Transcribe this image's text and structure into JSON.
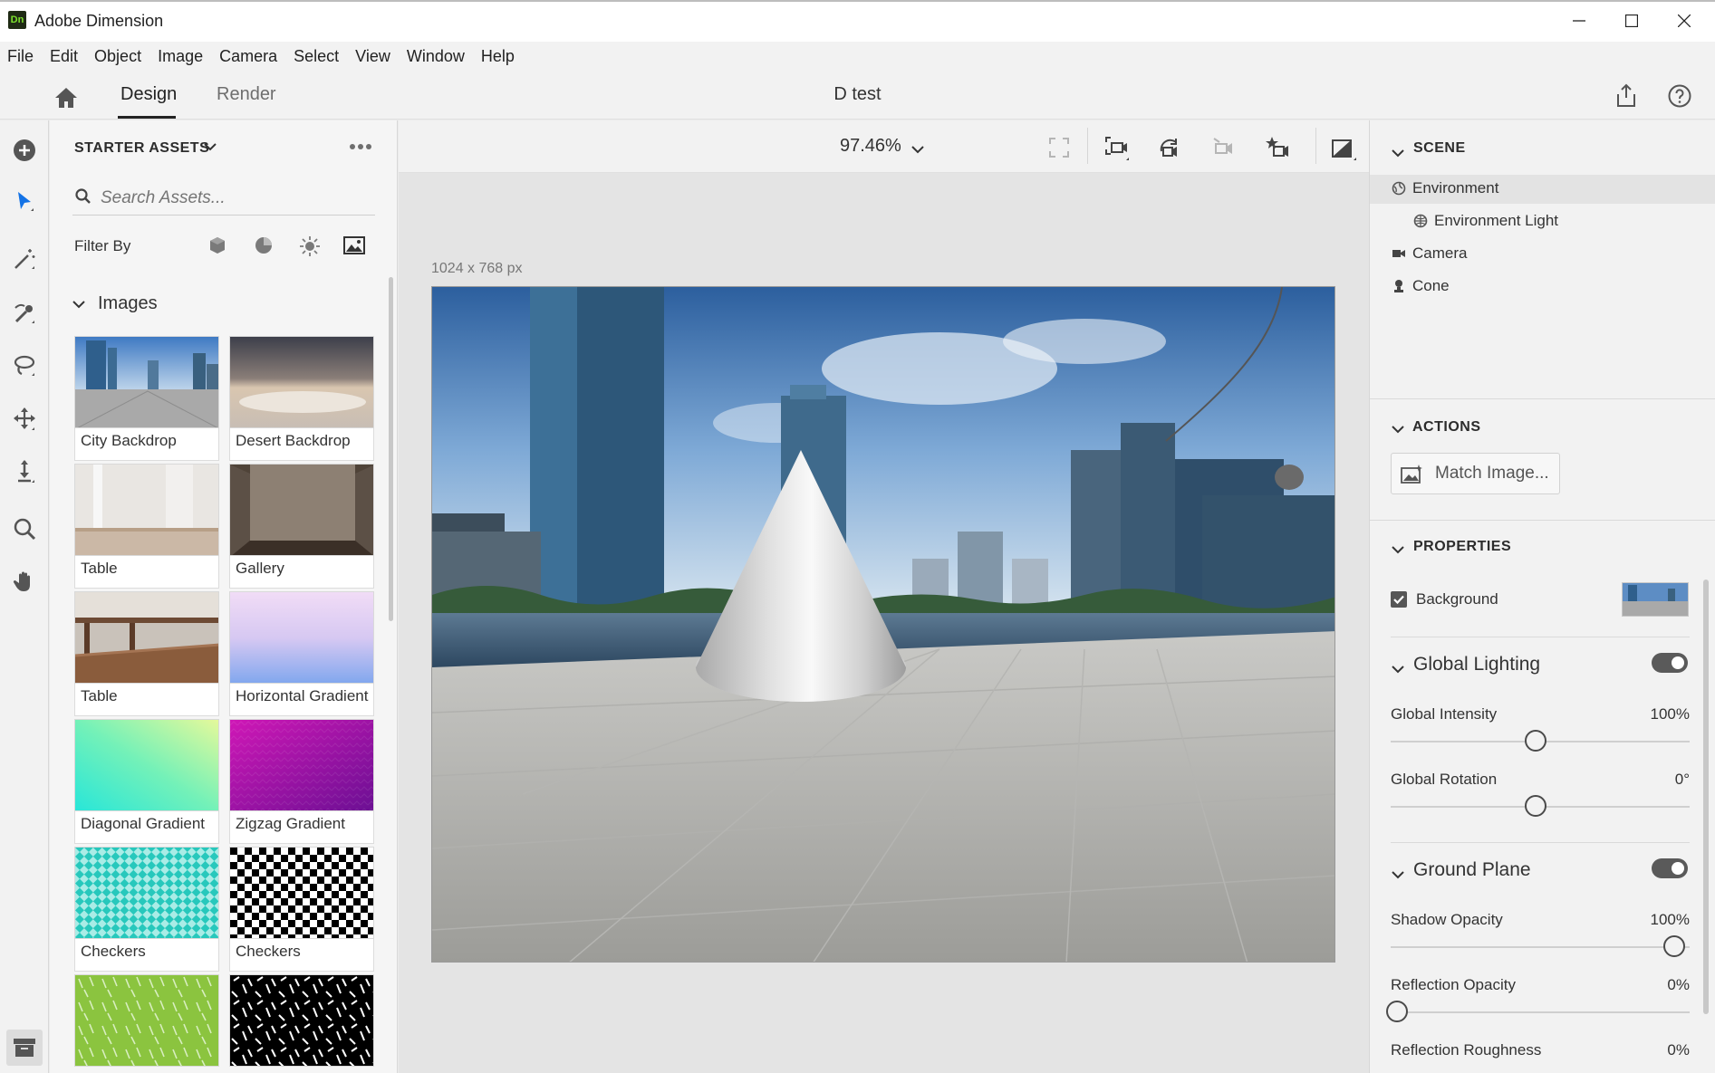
{
  "app": {
    "title": "Adobe Dimension",
    "logo_text": "Dn"
  },
  "menu": [
    "File",
    "Edit",
    "Object",
    "Image",
    "Camera",
    "Select",
    "View",
    "Window",
    "Help"
  ],
  "header": {
    "tab_design": "Design",
    "tab_render": "Render",
    "document_title": "D test"
  },
  "assets": {
    "title": "STARTER ASSETS",
    "search_placeholder": "Search Assets...",
    "filter_label": "Filter By",
    "section": "Images",
    "items": [
      {
        "label": "City Backdrop"
      },
      {
        "label": "Desert Backdrop"
      },
      {
        "label": "Table"
      },
      {
        "label": "Gallery"
      },
      {
        "label": "Table"
      },
      {
        "label": "Horizontal Gradient"
      },
      {
        "label": "Diagonal Gradient"
      },
      {
        "label": "Zigzag Gradient"
      },
      {
        "label": "Checkers"
      },
      {
        "label": "Checkers"
      }
    ]
  },
  "canvas": {
    "zoom": "97.46%",
    "dimensions": "1024 x 768 px"
  },
  "scene": {
    "title": "SCENE",
    "items": [
      "Environment",
      "Environment Light",
      "Camera",
      "Cone"
    ]
  },
  "actions": {
    "title": "ACTIONS",
    "match_image": "Match Image..."
  },
  "properties": {
    "title": "PROPERTIES",
    "background_label": "Background",
    "global_lighting": {
      "title": "Global Lighting",
      "intensity_label": "Global Intensity",
      "intensity_value": "100%",
      "rotation_label": "Global Rotation",
      "rotation_value": "0°"
    },
    "ground_plane": {
      "title": "Ground Plane",
      "shadow_label": "Shadow Opacity",
      "shadow_value": "100%",
      "reflection_label": "Reflection Opacity",
      "reflection_value": "0%",
      "roughness_label": "Reflection Roughness",
      "roughness_value": "0%"
    }
  },
  "colors": {
    "accent": "#1473e6",
    "logo_bg": "#1f2a14",
    "logo_fg": "#7be02c"
  }
}
